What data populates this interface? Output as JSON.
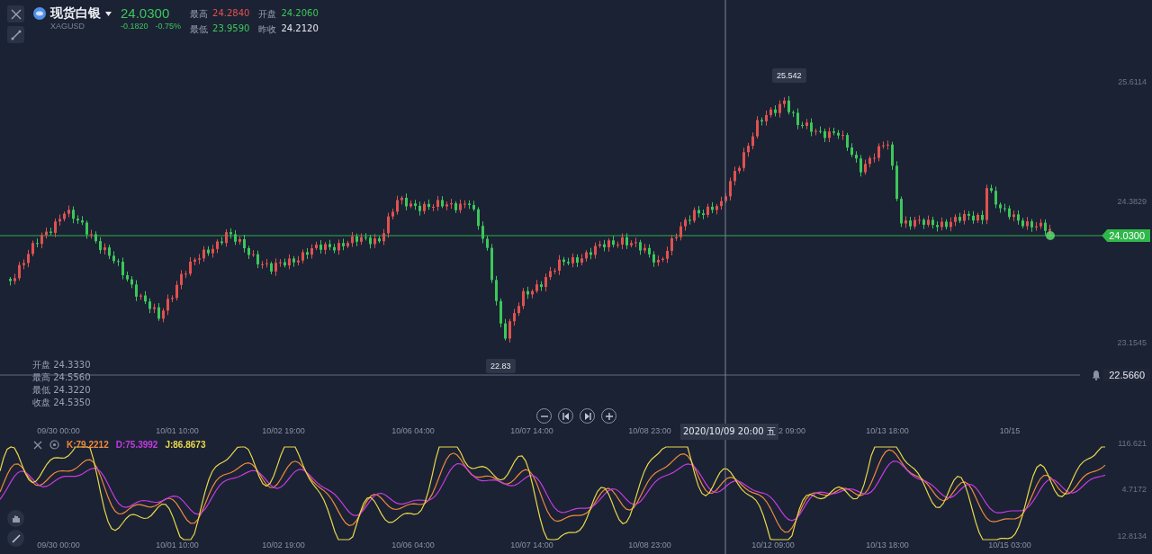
{
  "instrument": {
    "name": "现货白银",
    "symbol": "XAGUSD",
    "price": "24.0300",
    "change": "-0.1820",
    "change_pct": "-0.75%"
  },
  "quote_stats": [
    {
      "label": "最高",
      "value": "24.2840",
      "color": "#e0524f"
    },
    {
      "label": "开盘",
      "value": "24.2060",
      "color": "#3cc75a"
    },
    {
      "label": "最低",
      "value": "23.9590",
      "color": "#3cc75a"
    },
    {
      "label": "昨收",
      "value": "24.2120",
      "color": "#e8eaf0"
    }
  ],
  "price_axis": [
    "25.6114",
    "24.3829",
    "23.1545"
  ],
  "last_price_tag": "24.0300",
  "alert_line": {
    "price": "22.5660"
  },
  "high_marker": "25.542",
  "low_marker": "22.83",
  "ohlc_readout": [
    {
      "label": "开盘",
      "value": "24.3330"
    },
    {
      "label": "最高",
      "value": "24.5560"
    },
    {
      "label": "最低",
      "value": "24.3220"
    },
    {
      "label": "收盘",
      "value": "24.5350"
    }
  ],
  "time_axis": [
    "09/30 00:00",
    "10/01 10:00",
    "10/02 19:00",
    "10/06 04:00",
    "10/07 14:00",
    "10/08 23:00",
    "2 09:00",
    "10/13 18:00",
    "10/15"
  ],
  "crosshair_label": "2020/10/09 20:00 五",
  "kdj": {
    "values": [
      {
        "label": "K:79.2212",
        "color": "#f08a3c"
      },
      {
        "label": "D:75.3992",
        "color": "#c43be0"
      },
      {
        "label": "J:86.8673",
        "color": "#e8d84a"
      }
    ],
    "axis": [
      "116.621",
      "4.7172",
      "12.8134"
    ]
  },
  "bottom_time_axis": [
    "09/30 00:00",
    "10/01 10:00",
    "10/02 19:00",
    "10/06 04:00",
    "10/07 14:00",
    "10/08 23:00",
    "10/12 09:00",
    "10/13 18:00",
    "10/15 03:00"
  ]
}
